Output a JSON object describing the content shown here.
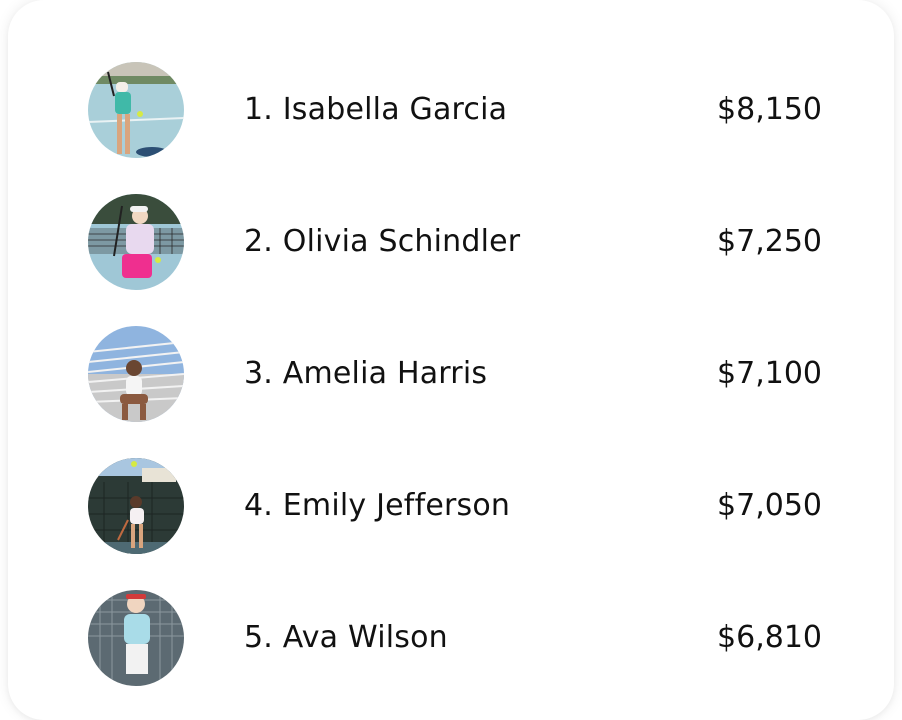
{
  "leaderboard": {
    "entries": [
      {
        "rank_name": "1. Isabella Garcia",
        "amount": "$8,150",
        "avatar_icon": "player-photo"
      },
      {
        "rank_name": "2. Olivia Schindler",
        "amount": "$7,250",
        "avatar_icon": "player-photo"
      },
      {
        "rank_name": "3. Amelia Harris",
        "amount": "$7,100",
        "avatar_icon": "player-photo"
      },
      {
        "rank_name": "4. Emily Jefferson",
        "amount": "$7,050",
        "avatar_icon": "player-photo"
      },
      {
        "rank_name": "5. Ava Wilson",
        "amount": "$6,810",
        "avatar_icon": "player-photo"
      }
    ]
  }
}
